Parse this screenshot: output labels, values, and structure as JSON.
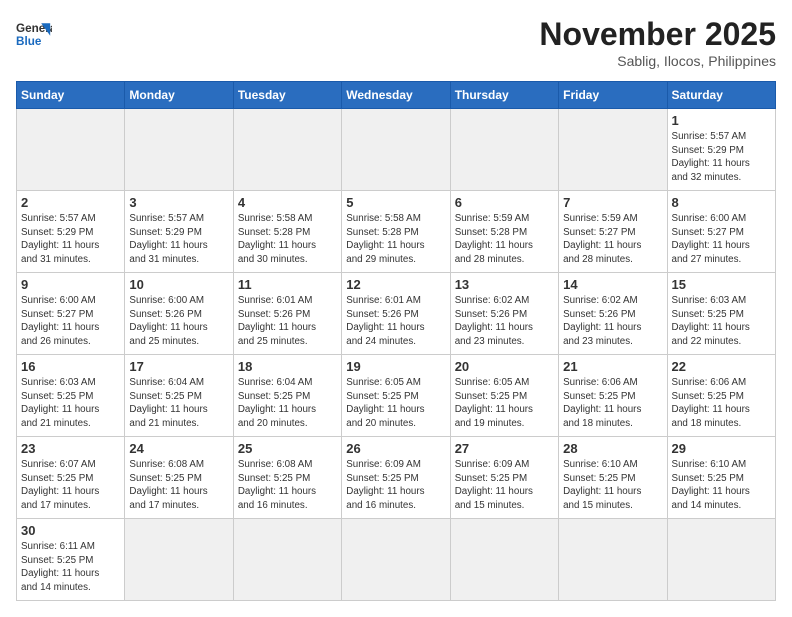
{
  "header": {
    "logo_line1": "General",
    "logo_line2": "Blue",
    "month": "November 2025",
    "location": "Sablig, Ilocos, Philippines"
  },
  "weekdays": [
    "Sunday",
    "Monday",
    "Tuesday",
    "Wednesday",
    "Thursday",
    "Friday",
    "Saturday"
  ],
  "weeks": [
    [
      {
        "day": "",
        "info": ""
      },
      {
        "day": "",
        "info": ""
      },
      {
        "day": "",
        "info": ""
      },
      {
        "day": "",
        "info": ""
      },
      {
        "day": "",
        "info": ""
      },
      {
        "day": "",
        "info": ""
      },
      {
        "day": "1",
        "info": "Sunrise: 5:57 AM\nSunset: 5:29 PM\nDaylight: 11 hours\nand 32 minutes."
      }
    ],
    [
      {
        "day": "2",
        "info": "Sunrise: 5:57 AM\nSunset: 5:29 PM\nDaylight: 11 hours\nand 31 minutes."
      },
      {
        "day": "3",
        "info": "Sunrise: 5:57 AM\nSunset: 5:29 PM\nDaylight: 11 hours\nand 31 minutes."
      },
      {
        "day": "4",
        "info": "Sunrise: 5:58 AM\nSunset: 5:28 PM\nDaylight: 11 hours\nand 30 minutes."
      },
      {
        "day": "5",
        "info": "Sunrise: 5:58 AM\nSunset: 5:28 PM\nDaylight: 11 hours\nand 29 minutes."
      },
      {
        "day": "6",
        "info": "Sunrise: 5:59 AM\nSunset: 5:28 PM\nDaylight: 11 hours\nand 28 minutes."
      },
      {
        "day": "7",
        "info": "Sunrise: 5:59 AM\nSunset: 5:27 PM\nDaylight: 11 hours\nand 28 minutes."
      },
      {
        "day": "8",
        "info": "Sunrise: 6:00 AM\nSunset: 5:27 PM\nDaylight: 11 hours\nand 27 minutes."
      }
    ],
    [
      {
        "day": "9",
        "info": "Sunrise: 6:00 AM\nSunset: 5:27 PM\nDaylight: 11 hours\nand 26 minutes."
      },
      {
        "day": "10",
        "info": "Sunrise: 6:00 AM\nSunset: 5:26 PM\nDaylight: 11 hours\nand 25 minutes."
      },
      {
        "day": "11",
        "info": "Sunrise: 6:01 AM\nSunset: 5:26 PM\nDaylight: 11 hours\nand 25 minutes."
      },
      {
        "day": "12",
        "info": "Sunrise: 6:01 AM\nSunset: 5:26 PM\nDaylight: 11 hours\nand 24 minutes."
      },
      {
        "day": "13",
        "info": "Sunrise: 6:02 AM\nSunset: 5:26 PM\nDaylight: 11 hours\nand 23 minutes."
      },
      {
        "day": "14",
        "info": "Sunrise: 6:02 AM\nSunset: 5:26 PM\nDaylight: 11 hours\nand 23 minutes."
      },
      {
        "day": "15",
        "info": "Sunrise: 6:03 AM\nSunset: 5:25 PM\nDaylight: 11 hours\nand 22 minutes."
      }
    ],
    [
      {
        "day": "16",
        "info": "Sunrise: 6:03 AM\nSunset: 5:25 PM\nDaylight: 11 hours\nand 21 minutes."
      },
      {
        "day": "17",
        "info": "Sunrise: 6:04 AM\nSunset: 5:25 PM\nDaylight: 11 hours\nand 21 minutes."
      },
      {
        "day": "18",
        "info": "Sunrise: 6:04 AM\nSunset: 5:25 PM\nDaylight: 11 hours\nand 20 minutes."
      },
      {
        "day": "19",
        "info": "Sunrise: 6:05 AM\nSunset: 5:25 PM\nDaylight: 11 hours\nand 20 minutes."
      },
      {
        "day": "20",
        "info": "Sunrise: 6:05 AM\nSunset: 5:25 PM\nDaylight: 11 hours\nand 19 minutes."
      },
      {
        "day": "21",
        "info": "Sunrise: 6:06 AM\nSunset: 5:25 PM\nDaylight: 11 hours\nand 18 minutes."
      },
      {
        "day": "22",
        "info": "Sunrise: 6:06 AM\nSunset: 5:25 PM\nDaylight: 11 hours\nand 18 minutes."
      }
    ],
    [
      {
        "day": "23",
        "info": "Sunrise: 6:07 AM\nSunset: 5:25 PM\nDaylight: 11 hours\nand 17 minutes."
      },
      {
        "day": "24",
        "info": "Sunrise: 6:08 AM\nSunset: 5:25 PM\nDaylight: 11 hours\nand 17 minutes."
      },
      {
        "day": "25",
        "info": "Sunrise: 6:08 AM\nSunset: 5:25 PM\nDaylight: 11 hours\nand 16 minutes."
      },
      {
        "day": "26",
        "info": "Sunrise: 6:09 AM\nSunset: 5:25 PM\nDaylight: 11 hours\nand 16 minutes."
      },
      {
        "day": "27",
        "info": "Sunrise: 6:09 AM\nSunset: 5:25 PM\nDaylight: 11 hours\nand 15 minutes."
      },
      {
        "day": "28",
        "info": "Sunrise: 6:10 AM\nSunset: 5:25 PM\nDaylight: 11 hours\nand 15 minutes."
      },
      {
        "day": "29",
        "info": "Sunrise: 6:10 AM\nSunset: 5:25 PM\nDaylight: 11 hours\nand 14 minutes."
      }
    ],
    [
      {
        "day": "30",
        "info": "Sunrise: 6:11 AM\nSunset: 5:25 PM\nDaylight: 11 hours\nand 14 minutes."
      },
      {
        "day": "",
        "info": ""
      },
      {
        "day": "",
        "info": ""
      },
      {
        "day": "",
        "info": ""
      },
      {
        "day": "",
        "info": ""
      },
      {
        "day": "",
        "info": ""
      },
      {
        "day": "",
        "info": ""
      }
    ]
  ]
}
